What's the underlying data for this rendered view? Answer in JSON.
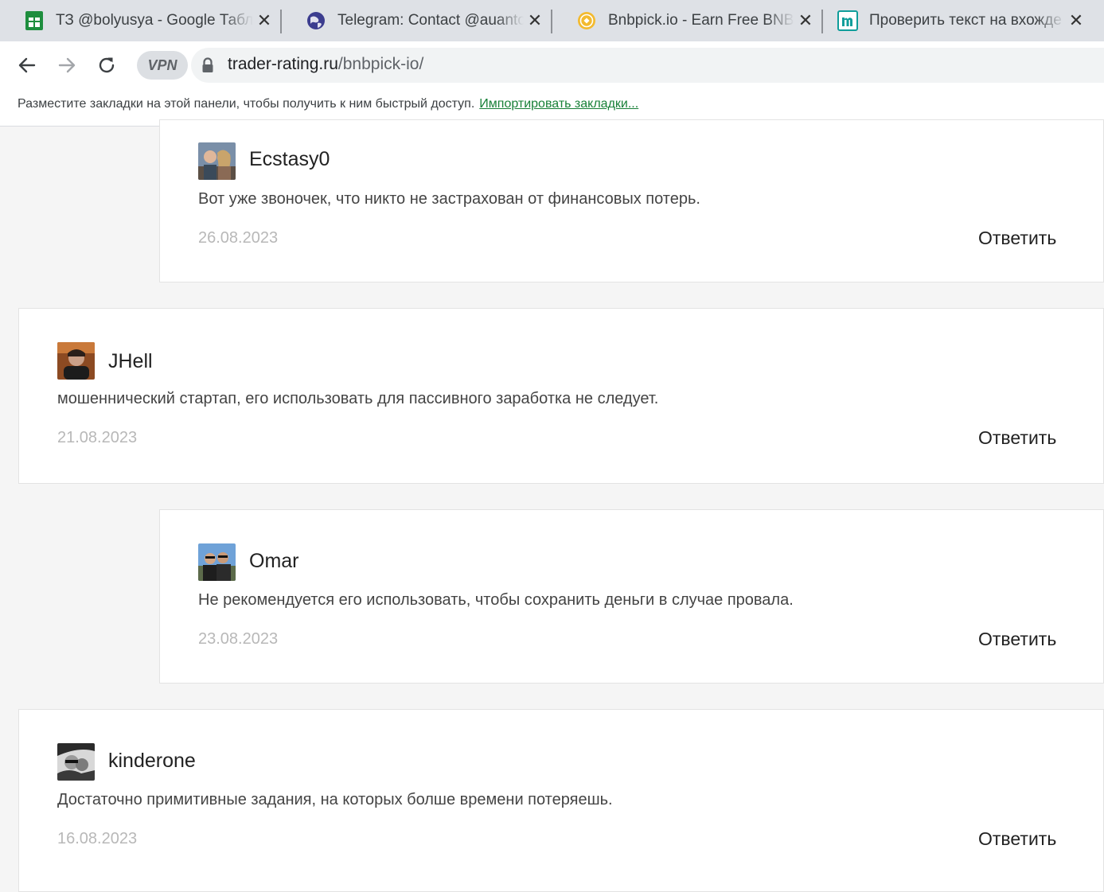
{
  "browser": {
    "tabs": [
      {
        "title": "ТЗ @bolyusya - Google Табл",
        "favicon": "sheets-icon",
        "color": "#1e8e3e"
      },
      {
        "title": "Telegram: Contact @auanton",
        "favicon": "globe-icon",
        "color": "#3c3d8f"
      },
      {
        "title": "Bnbpick.io - Earn Free BNB, F",
        "favicon": "bnb-coin-icon",
        "color": "#f3ba2f"
      },
      {
        "title": "Проверить текст на вхожде",
        "favicon": "m-logo-icon",
        "color": "#0f9d9a"
      }
    ],
    "close_glyph": "✕",
    "vpn_label": "VPN",
    "url_host": "trader-rating.ru",
    "url_path": "/bnbpick-io/"
  },
  "bookmarks_bar": {
    "message": "Разместите закладки на этой панели, чтобы получить к ним быстрый доступ.",
    "import_link": "Импортировать закладки..."
  },
  "comments": [
    {
      "author": "Ecstasy0",
      "text": "Вот уже звоночек, что никто не застрахован от финансовых потерь.",
      "date": "26.08.2023",
      "reply": "Ответить",
      "nested": true
    },
    {
      "author": "JHell",
      "text": "мошеннический стартап, его использовать для пассивного заработка не следует.",
      "date": "21.08.2023",
      "reply": "Ответить",
      "nested": false
    },
    {
      "author": "Omar",
      "text": "Не рекомендуется его использовать, чтобы сохранить деньги в случае провала.",
      "date": "23.08.2023",
      "reply": "Ответить",
      "nested": true
    },
    {
      "author": "kinderone",
      "text": "Достаточно примитивные задания, на которых болше времени потеряешь.",
      "date": "16.08.2023",
      "reply": "Ответить",
      "nested": false
    }
  ]
}
